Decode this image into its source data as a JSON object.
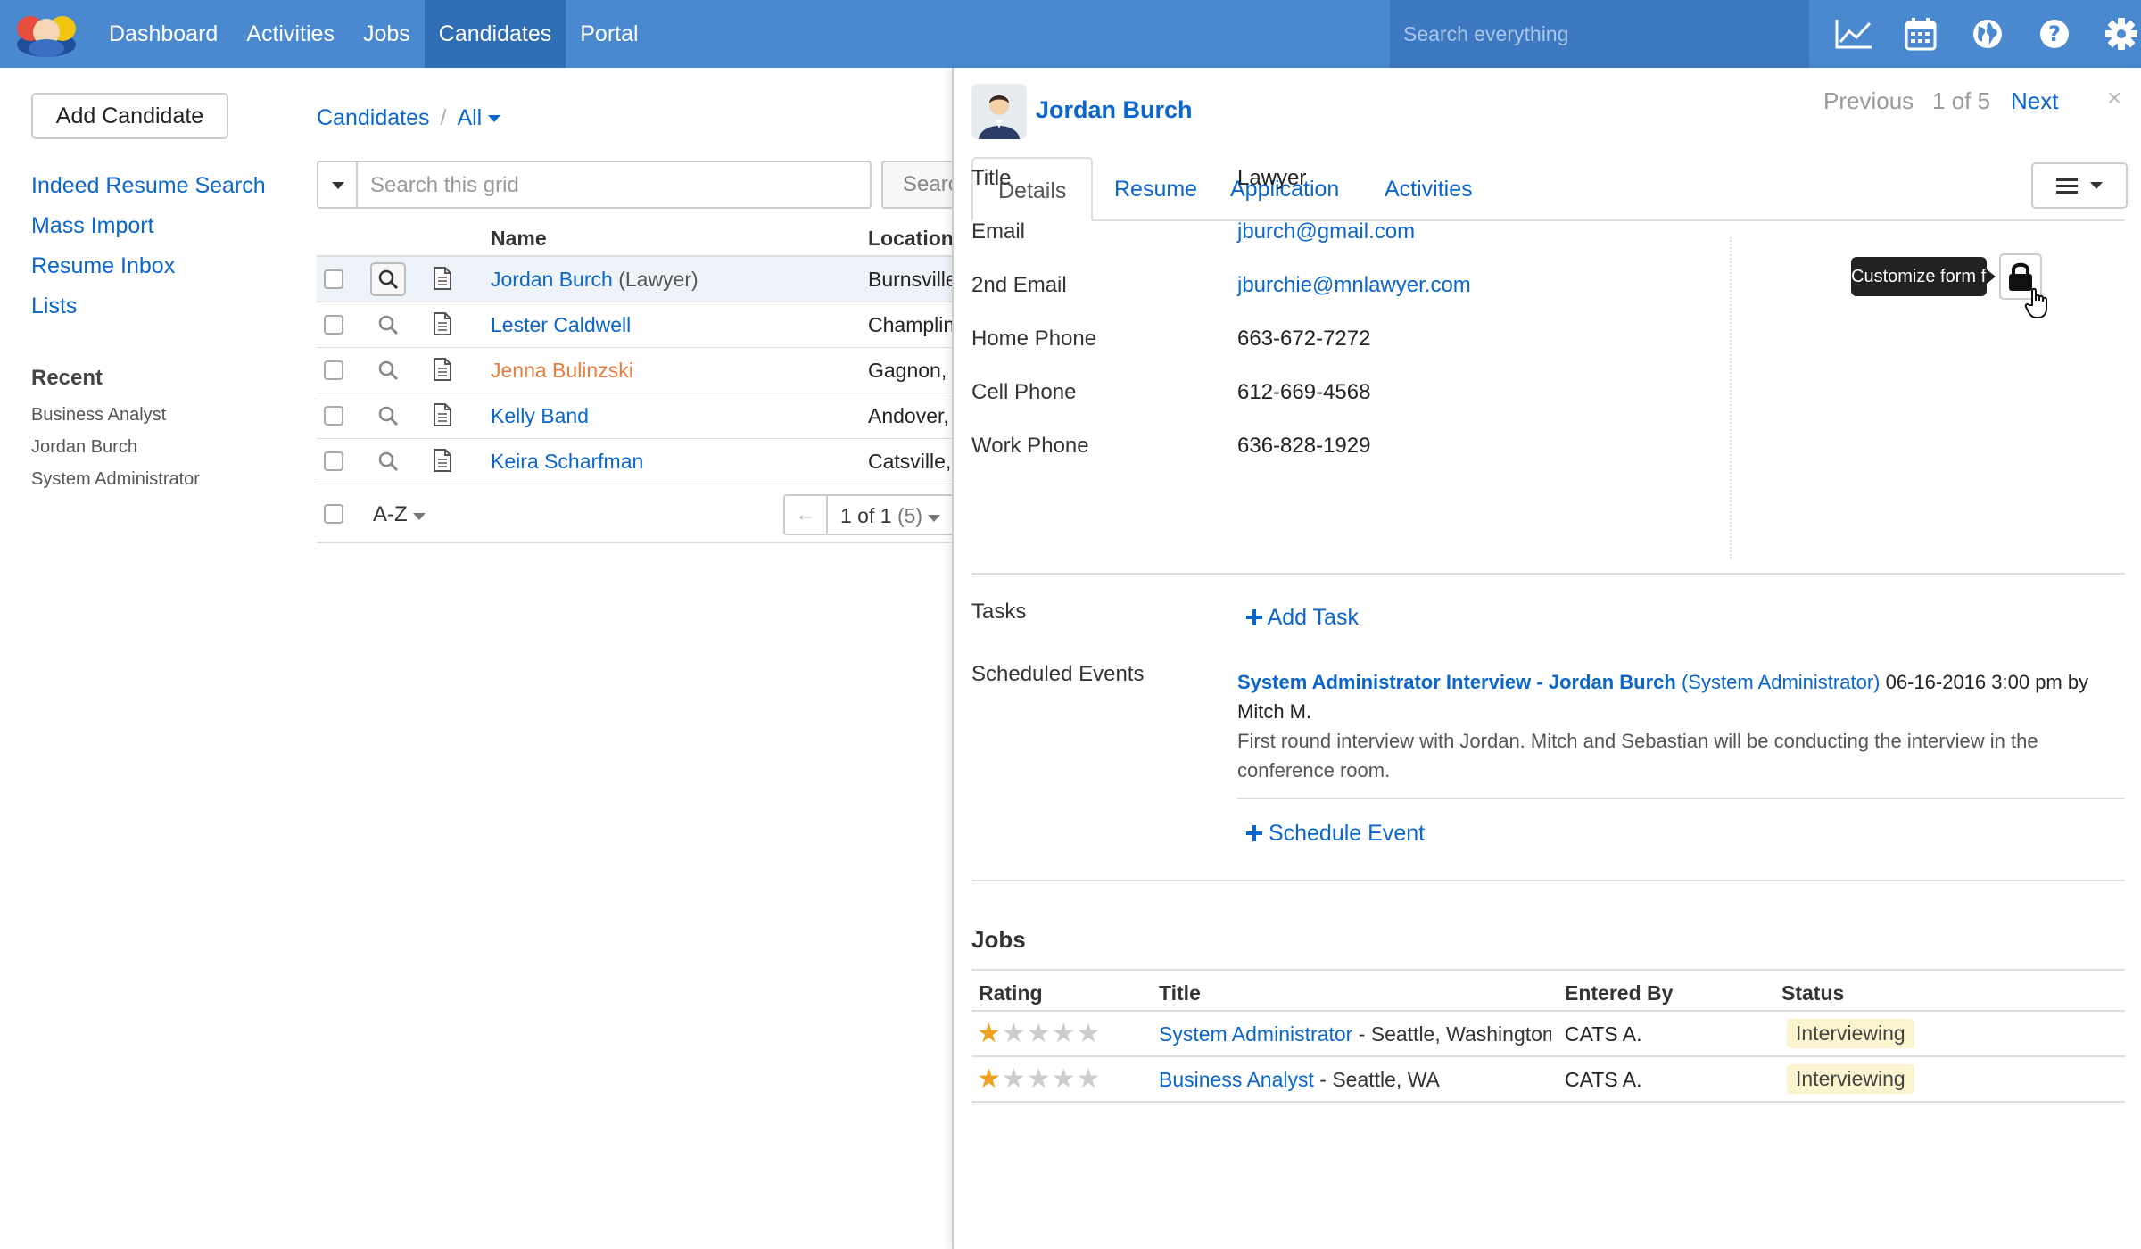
{
  "topbar": {
    "nav": [
      "Dashboard",
      "Activities",
      "Jobs",
      "Candidates",
      "Portal"
    ],
    "active_nav": "Candidates",
    "search_placeholder": "Search everything",
    "icons": [
      "chart-icon",
      "calendar-icon",
      "globe-icon",
      "help-icon",
      "gear-icon"
    ]
  },
  "sidebar": {
    "add_button": "Add Candidate",
    "links": [
      "Indeed Resume Search",
      "Mass Import",
      "Resume Inbox",
      "Lists"
    ],
    "recent_heading": "Recent",
    "recent": [
      "Business Analyst",
      "Jordan Burch",
      "System Administrator"
    ]
  },
  "list": {
    "breadcrumb_root": "Candidates",
    "breadcrumb_sep": "/",
    "breadcrumb_filter": "All",
    "search_placeholder": "Search this grid",
    "search_button": "Search",
    "columns": {
      "name": "Name",
      "location": "Location"
    },
    "rows": [
      {
        "name": "Jordan Burch",
        "suffix": "(Lawyer)",
        "location": "Burnsville",
        "highlight": false
      },
      {
        "name": "Lester Caldwell",
        "suffix": "",
        "location": "Champlin",
        "highlight": false
      },
      {
        "name": "Jenna Bulinzski",
        "suffix": "",
        "location": "Gagnon,",
        "highlight": true
      },
      {
        "name": "Kelly Band",
        "suffix": "",
        "location": "Andover,",
        "highlight": false
      },
      {
        "name": "Keira Scharfman",
        "suffix": "",
        "location": "Catsville,",
        "highlight": false
      }
    ],
    "sort_label": "A-Z",
    "pager_text": "1 of 1",
    "pager_total": "(5)"
  },
  "detail": {
    "name": "Jordan Burch",
    "nav_prev": "Previous",
    "nav_count": "1 of 5",
    "nav_next": "Next",
    "close": "×",
    "tabs": [
      "Details",
      "Resume",
      "Application",
      "Activities"
    ],
    "fields": [
      {
        "label": "Title",
        "value": "Lawyer",
        "link": false
      },
      {
        "label": "Email",
        "value": "jburch@gmail.com",
        "link": true
      },
      {
        "label": "2nd Email",
        "value": "jburchie@mnlawyer.com",
        "link": true
      },
      {
        "label": "Home Phone",
        "value": "663-672-7272",
        "link": false
      },
      {
        "label": "Cell Phone",
        "value": "612-669-4568",
        "link": false
      },
      {
        "label": "Work Phone",
        "value": "636-828-1929",
        "link": false
      }
    ],
    "tooltip": "Customize form fields",
    "tasks_label": "Tasks",
    "add_task": "Add Task",
    "events_label": "Scheduled Events",
    "event": {
      "title": "System Administrator Interview - Jordan Burch",
      "job": "(System Administrator)",
      "datetime": "06-16-2016 3:00 pm by",
      "by": "Mitch M.",
      "description": "First round interview with Jordan. Mitch and Sebastian will be conducting the interview in the conference room."
    },
    "schedule_event": "Schedule Event",
    "jobs_heading": "Jobs",
    "jobs_columns": [
      "Rating",
      "Title",
      "Entered By",
      "Status"
    ],
    "jobs": [
      {
        "rating": 1,
        "title": "System Administrator",
        "location": "- Seattle, Washington",
        "entered_by": "CATS A.",
        "status": "Interviewing"
      },
      {
        "rating": 1,
        "title": "Business Analyst",
        "location": "- Seattle, WA",
        "entered_by": "CATS A.",
        "status": "Interviewing"
      }
    ]
  },
  "colors": {
    "topbar": "#4a88cf",
    "topbar_active": "#2f6db5",
    "link": "#0a66cc",
    "highlight_name": "#e87d3e",
    "star": "#f0a020",
    "badge": "#fcf3cf"
  }
}
